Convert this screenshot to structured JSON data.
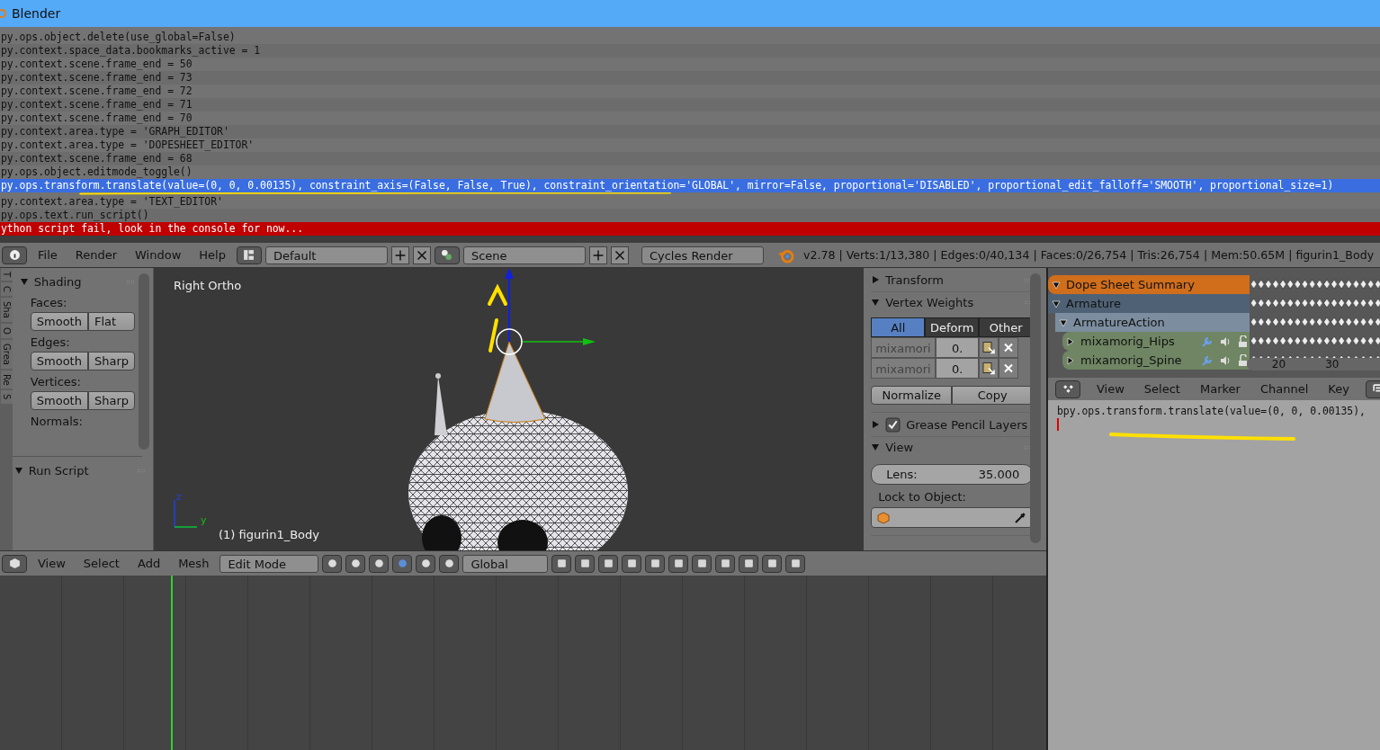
{
  "window": {
    "title": "Blender"
  },
  "console": {
    "lines": [
      {
        "text": "py.ops.object.delete(use_global=False)",
        "kind": "normal"
      },
      {
        "text": "py.context.space_data.bookmarks_active = 1",
        "kind": "normal"
      },
      {
        "text": "py.context.scene.frame_end = 50",
        "kind": "normal"
      },
      {
        "text": "py.context.scene.frame_end = 73",
        "kind": "normal"
      },
      {
        "text": "py.context.scene.frame_end = 72",
        "kind": "normal"
      },
      {
        "text": "py.context.scene.frame_end = 71",
        "kind": "normal"
      },
      {
        "text": "py.context.scene.frame_end = 70",
        "kind": "normal"
      },
      {
        "text": "py.context.area.type = 'GRAPH_EDITOR'",
        "kind": "normal"
      },
      {
        "text": "py.context.area.type = 'DOPESHEET_EDITOR'",
        "kind": "normal"
      },
      {
        "text": "py.context.scene.frame_end = 68",
        "kind": "normal"
      },
      {
        "text": "py.ops.object.editmode_toggle()",
        "kind": "normal"
      },
      {
        "text": "py.ops.transform.translate(value=(0, 0, 0.00135), constraint_axis=(False, False, True), constraint_orientation='GLOBAL', mirror=False, proportional='DISABLED', proportional_edit_falloff='SMOOTH', proportional_size=1)",
        "kind": "selected"
      },
      {
        "text": "py.context.area.type = 'TEXT_EDITOR'",
        "kind": "normal"
      },
      {
        "text": "py.ops.text.run_script()",
        "kind": "normal"
      },
      {
        "text": "ython script fail, look in the console for now...",
        "kind": "error"
      }
    ]
  },
  "info_header": {
    "menus": [
      "File",
      "Render",
      "Window",
      "Help"
    ],
    "screen_layout": "Default",
    "scene": "Scene",
    "render_engine": "Cycles Render",
    "stats": "v2.78 | Verts:1/13,380 | Edges:0/40,134 | Faces:0/26,754 | Tris:26,754 | Mem:50.65M | figurin1_Body"
  },
  "tool_shelf": {
    "tabs": [
      "T",
      "C",
      "Sha",
      "O",
      "Grea",
      "Re",
      "S"
    ],
    "panels": [
      {
        "title": "Shading",
        "expanded": true,
        "groups": [
          {
            "label": "Faces:",
            "buttons": [
              "Smooth",
              "Flat"
            ]
          },
          {
            "label": "Edges:",
            "buttons": [
              "Smooth",
              "Sharp"
            ]
          },
          {
            "label": "Vertices:",
            "buttons": [
              "Smooth",
              "Sharp"
            ]
          },
          {
            "label": "Normals:"
          }
        ]
      },
      {
        "title": "Run Script",
        "expanded": true
      }
    ]
  },
  "viewport": {
    "view_name": "Right Ortho",
    "object_label": "(1) figurin1_Body",
    "axis_z": "z",
    "axis_y": "y"
  },
  "properties": {
    "transform": {
      "title": "Transform",
      "expanded": false
    },
    "vertex_weights": {
      "title": "Vertex Weights",
      "expanded": true,
      "filters": [
        {
          "label": "All",
          "selected": true
        },
        {
          "label": "Deform",
          "selected": false
        },
        {
          "label": "Other",
          "selected": false
        }
      ],
      "groups": [
        {
          "name": "mixamori",
          "value": "0."
        },
        {
          "name": "mixamori",
          "value": "0."
        }
      ],
      "buttons": [
        "Normalize",
        "Copy"
      ]
    },
    "grease_pencil": {
      "title": "Grease Pencil Layers",
      "expanded": false,
      "checked": true
    },
    "view": {
      "title": "View",
      "expanded": true,
      "lens_label": "Lens:",
      "lens_value": "35.000",
      "lock_label": "Lock to Object:"
    }
  },
  "dope_sheet": {
    "channels": [
      {
        "name": "Dope Sheet Summary",
        "kind": "summary",
        "expanded": true,
        "children": [
          {
            "name": "Armature",
            "kind": "object",
            "expanded": true,
            "children": [
              {
                "name": "ArmatureAction",
                "kind": "action",
                "expanded": true,
                "children": [
                  {
                    "name": "mixamorig_Hips",
                    "kind": "group",
                    "expanded": false
                  },
                  {
                    "name": "mixamorig_Spine",
                    "kind": "group",
                    "expanded": false
                  }
                ]
              }
            ]
          }
        ]
      }
    ],
    "frame_ticks": [
      "20",
      "30"
    ],
    "menus": [
      "View",
      "Select",
      "Marker",
      "Channel",
      "Key"
    ]
  },
  "text_editor": {
    "line": "bpy.ops.transform.translate(value=(0, 0, 0.00135),"
  },
  "view3d_header": {
    "menus": [
      "View",
      "Select",
      "Add",
      "Mesh"
    ],
    "mode": "Edit Mode",
    "orientation": "Global"
  }
}
